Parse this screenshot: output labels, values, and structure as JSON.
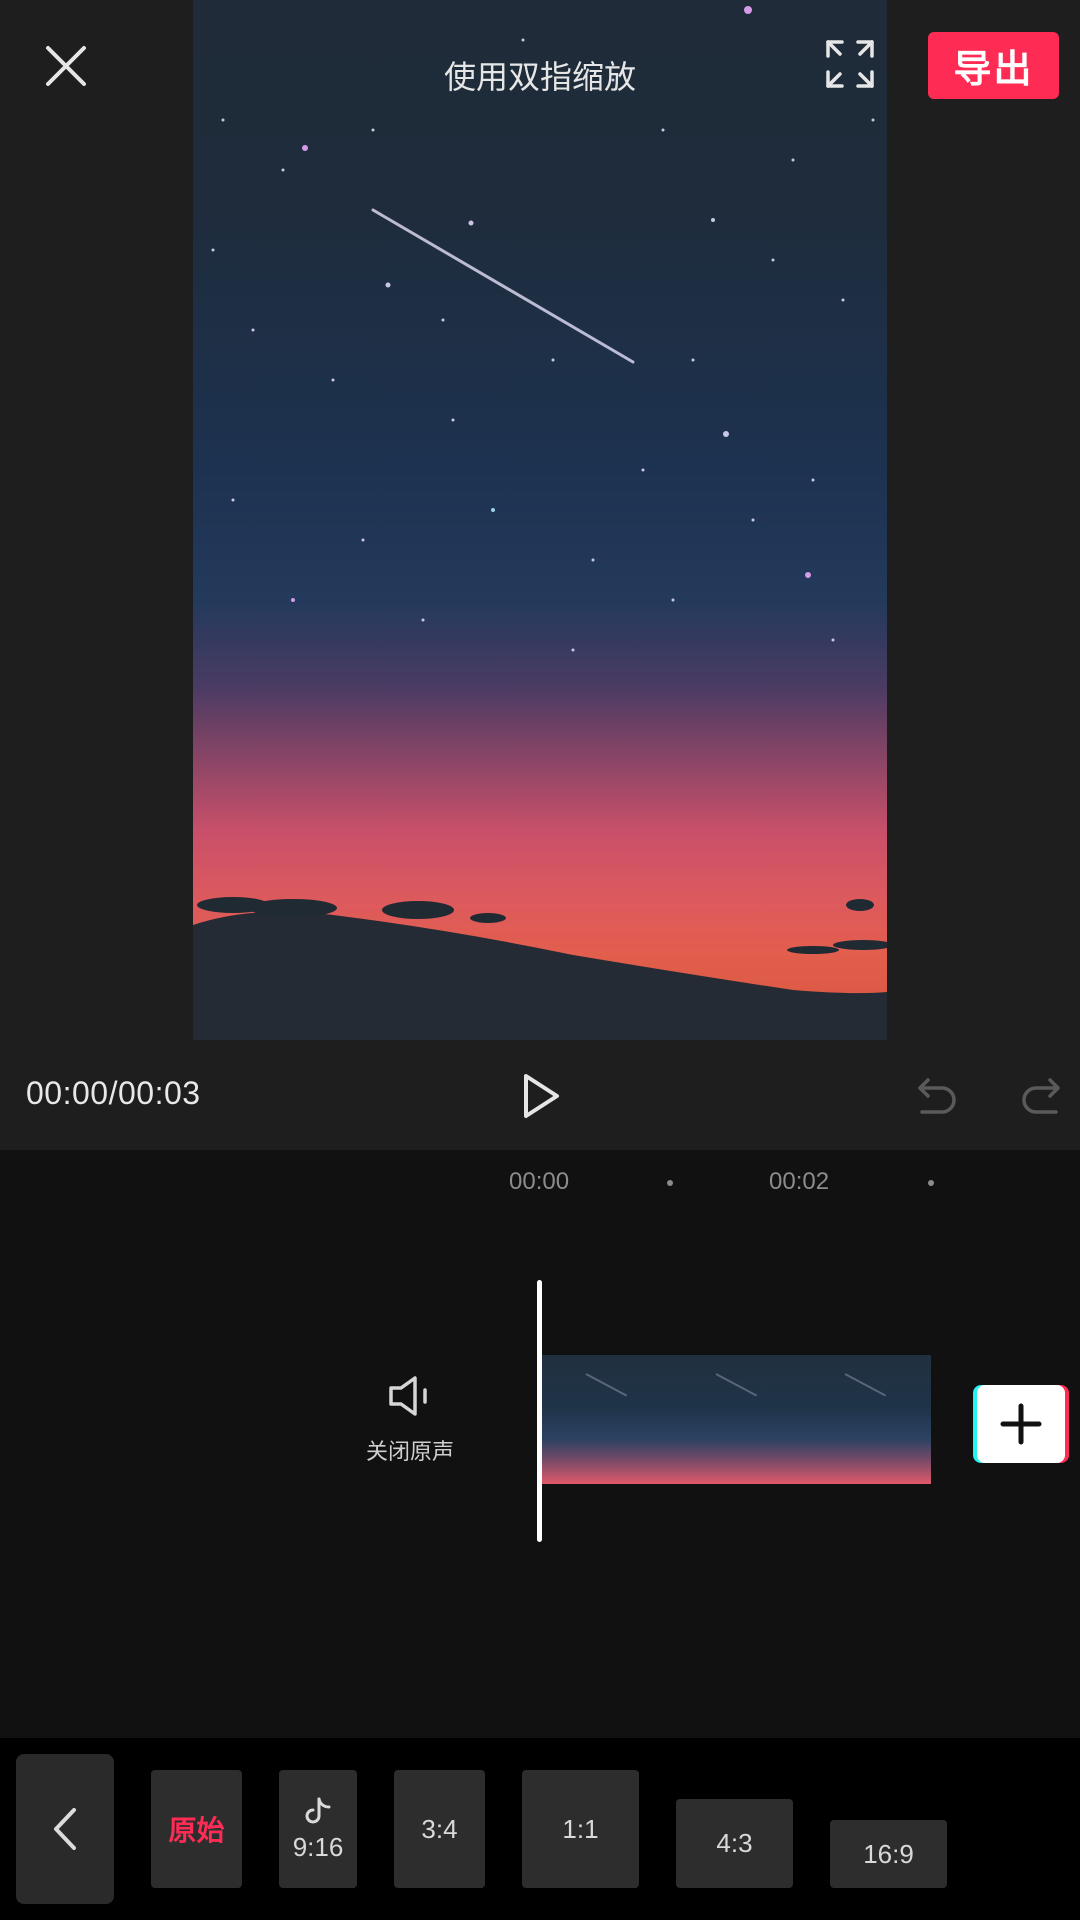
{
  "header": {
    "hint": "使用双指缩放",
    "export_label": "导出",
    "icons": {
      "close": "close-icon",
      "fullscreen": "fullscreen-icon"
    }
  },
  "player": {
    "time": "00:00/00:03",
    "icons": {
      "play": "play-icon",
      "undo": "undo-icon",
      "redo": "redo-icon"
    }
  },
  "timeline": {
    "ticks": [
      "00:00",
      "00:02"
    ],
    "mute_label": "关闭原声",
    "icons": {
      "mute": "speaker-icon",
      "add": "plus-icon"
    },
    "clip_thumbnails": 3
  },
  "ratios": {
    "items": [
      {
        "label": "原始",
        "active": true
      },
      {
        "label": "9:16",
        "icon": "tiktok-icon"
      },
      {
        "label": "3:4"
      },
      {
        "label": "1:1"
      },
      {
        "label": "4:3"
      },
      {
        "label": "16:9"
      }
    ],
    "accent": "#fe2c55"
  },
  "colors": {
    "accent": "#fe2c55",
    "cyan": "#25f4ee",
    "background": "#1e1e1e",
    "timeline_bg": "#111111"
  }
}
